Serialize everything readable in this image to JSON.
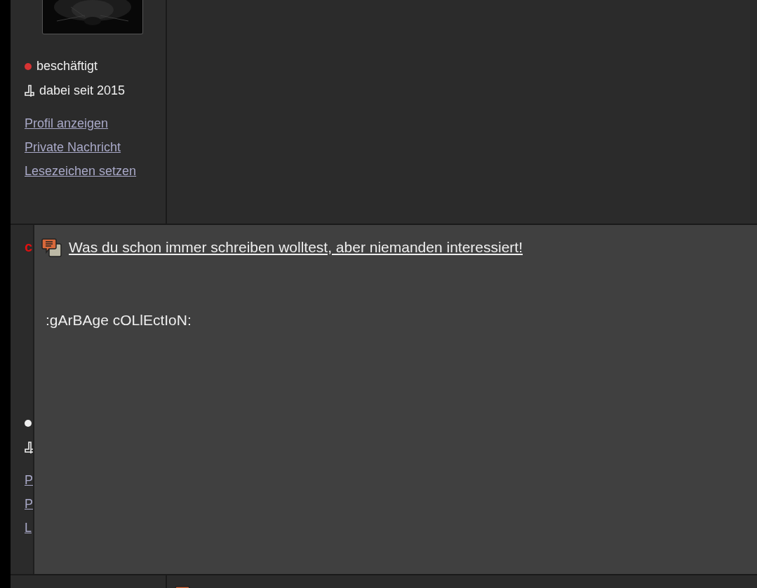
{
  "posts": [
    {
      "status": {
        "label": "beschäftigt",
        "color": "#d63333"
      },
      "member_since": "dabei seit 2015",
      "links": [
        "Profil anzeigen",
        "Private Nachricht",
        "Lesezeichen setzen"
      ]
    },
    {
      "username": "c",
      "status": {
        "color": "#eeeeee"
      },
      "links": [
        "P",
        "P",
        "L"
      ]
    },
    {
      "kind": "cut"
    }
  ],
  "popup": {
    "title": "Was du schon immer schreiben wolltest, aber niemanden interessiert!",
    "body": ":gArBAge cOLlEctIoN:"
  }
}
